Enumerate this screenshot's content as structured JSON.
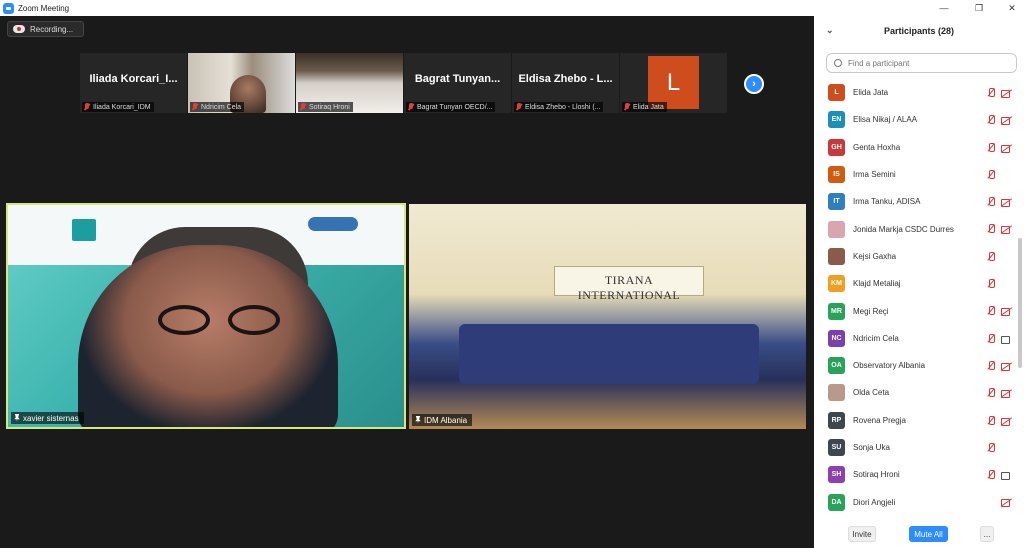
{
  "window": {
    "title": "Zoom Meeting",
    "minimize": "—",
    "maximize": "❐",
    "close": "✕"
  },
  "recording": {
    "label": "Recording..."
  },
  "thumbnails": [
    {
      "display_name": "Iliada  Korcari_I...",
      "label": "Iliada Korcari_IDM"
    },
    {
      "label": "Ndricim Cela"
    },
    {
      "label": "Sotiraq Hroni"
    },
    {
      "display_name": "Bagrat  Tunyan...",
      "label": "Bagrat Tunyan OECD/..."
    },
    {
      "display_name": "Eldisa  Zhebo - L...",
      "label": "Eldisa Zhebo - Lloshi (..."
    },
    {
      "avatar_letter": "L",
      "label": "Elida Jata"
    }
  ],
  "next_button": "›",
  "videos": {
    "main": {
      "label": "xavier sisternas"
    },
    "room": {
      "label": "IDM Albania",
      "sign": "TIRANA INTERNATIONAL"
    }
  },
  "panel": {
    "title": "Participants (28)",
    "collapse": "⌄",
    "search_placeholder": "Find a participant",
    "participants": [
      {
        "initials": "L",
        "name": "Elida Jata",
        "color": "#cf4c1d",
        "mic": "muted",
        "cam": "off"
      },
      {
        "initials": "EN",
        "name": "Elisa Nikaj / ALAA",
        "color": "#1b8fb8",
        "mic": "muted",
        "cam": "off"
      },
      {
        "initials": "GH",
        "name": "Genta Hoxha",
        "color": "#c8393b",
        "mic": "muted",
        "cam": "off"
      },
      {
        "initials": "IS",
        "name": "Irma Semini",
        "color": "#d25b12",
        "mic": "muted",
        "cam": ""
      },
      {
        "initials": "IT",
        "name": "Irma Tanku, ADISA",
        "color": "#2f7fbf",
        "mic": "muted",
        "cam": "off"
      },
      {
        "initials": "",
        "name": "Jonida Markja CSDC Durres",
        "color": "#d9a6b0",
        "mic": "muted",
        "cam": "off"
      },
      {
        "initials": "",
        "name": "Kejsi Gaxha",
        "color": "#8a5b4b",
        "mic": "muted",
        "cam": ""
      },
      {
        "initials": "KM",
        "name": "Klajd Metaliaj",
        "color": "#f0a020",
        "mic": "muted",
        "cam": ""
      },
      {
        "initials": "MR",
        "name": "Megi Reçi",
        "color": "#2aa35a",
        "mic": "muted",
        "cam": "off"
      },
      {
        "initials": "NC",
        "name": "Ndricim Cela",
        "color": "#7b3fb0",
        "mic": "muted",
        "cam": "on"
      },
      {
        "initials": "OA",
        "name": "Observatory Albania",
        "color": "#2aa35a",
        "mic": "muted",
        "cam": "off"
      },
      {
        "initials": "",
        "name": "Olda Ceta",
        "color": "#b79a8a",
        "mic": "muted",
        "cam": "off"
      },
      {
        "initials": "RP",
        "name": "Rovena Pregja",
        "color": "#3e4650",
        "mic": "muted",
        "cam": "off"
      },
      {
        "initials": "SU",
        "name": "Sonja Uka",
        "color": "#3e4650",
        "mic": "muted",
        "cam": ""
      },
      {
        "initials": "SH",
        "name": "Sotiraq Hroni",
        "color": "#8e3fb0",
        "mic": "muted",
        "cam": "on"
      },
      {
        "initials": "DA",
        "name": "Diori Angjeli",
        "color": "#2aa35a",
        "mic": "",
        "cam": "off"
      }
    ],
    "footer": {
      "invite": "Invite",
      "mute_all": "Mute All",
      "more": "..."
    }
  }
}
